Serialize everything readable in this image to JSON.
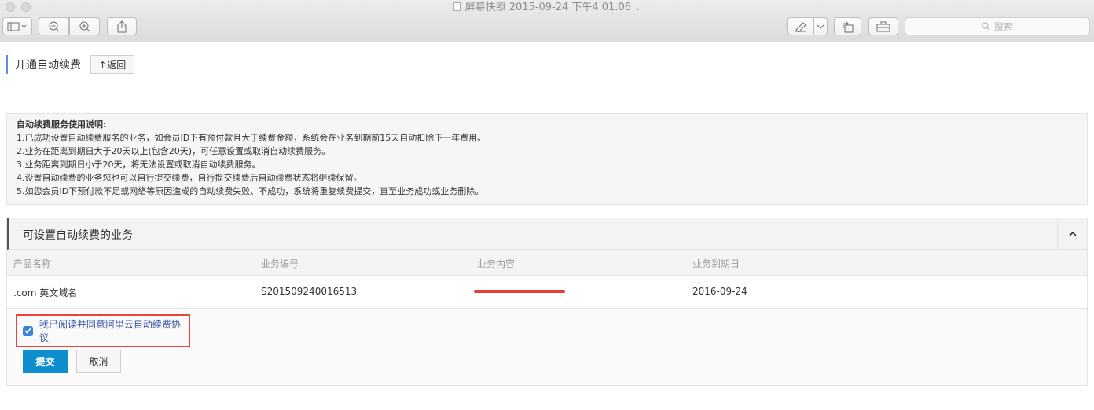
{
  "window": {
    "title": "屏幕快照 2015-09-24 下午4.01.06",
    "search_placeholder": "搜索"
  },
  "page": {
    "title": "开通自动续费",
    "back_label": "返回"
  },
  "notice": {
    "title": "自动续费服务使用说明:",
    "lines": [
      "1.已成功设置自动续费服务的业务，如会员ID下有预付款且大于续费金额，系统会在业务到期前15天自动扣除下一年费用。",
      "2.业务在距离到期日大于20天以上(包含20天)，可任意设置或取消自动续费服务。",
      "3.业务距离到期日小于20天，将无法设置或取消自动续费服务。",
      "4.设置自动续费的业务您也可以自行提交续费，自行提交续费后自动续费状态将继续保留。",
      "5.如您会员ID下预付款不足或网络等原因造成的自动续费失败、不成功，系统将重复续费提交，直至业务成功或业务删除。"
    ]
  },
  "panel": {
    "title": "可设置自动续费的业务",
    "columns": [
      "产品名称",
      "业务编号",
      "业务内容",
      "业务到期日"
    ],
    "rows": [
      {
        "product": ".com 英文域名",
        "id": "S201509240016513",
        "content": "",
        "expiry": "2016-09-24"
      }
    ],
    "agree_label": "我已阅读并同意阿里云自动续费协议",
    "agree_checked": true,
    "submit_label": "提交",
    "cancel_label": "取消"
  },
  "colors": {
    "accent": "#0d8fcf",
    "highlight_border": "#e8453c",
    "checkbox": "#3b82d6"
  }
}
